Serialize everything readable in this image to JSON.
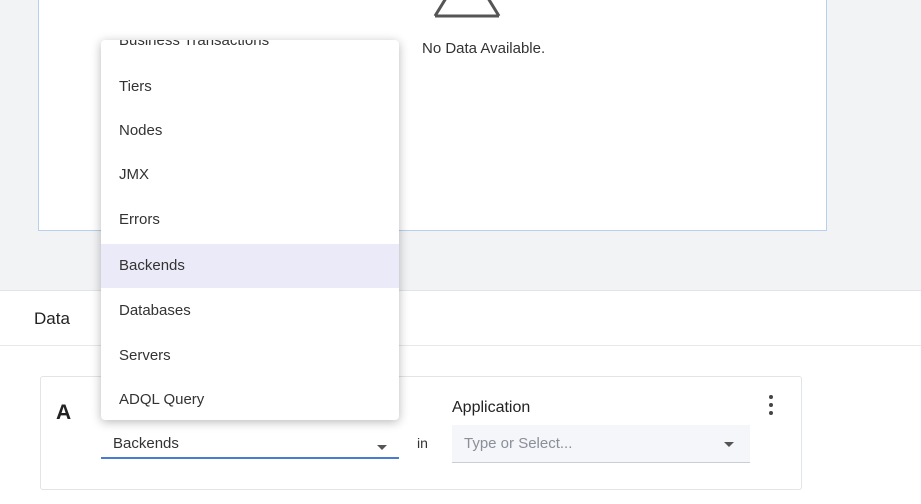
{
  "widget": {
    "no_data_text": "No Data Available.",
    "no_data_icon": "warning-triangle-icon"
  },
  "data_section": {
    "title": "Data"
  },
  "query": {
    "letter": "A",
    "metric_value": "Backends",
    "in_label": "in",
    "application_label": "Application",
    "application_placeholder": "Type or Select...",
    "menu_icon": "kebab-menu-icon"
  },
  "dropdown": {
    "items": [
      {
        "label": "Business Transactions"
      },
      {
        "label": "Tiers"
      },
      {
        "label": "Nodes"
      },
      {
        "label": "JMX"
      },
      {
        "label": "Errors"
      },
      {
        "label": "Backends",
        "selected": true
      },
      {
        "label": "Databases"
      },
      {
        "label": "Servers"
      },
      {
        "label": "ADQL Query"
      }
    ]
  },
  "colors": {
    "accent": "#4a7bd4",
    "selected_bg": "#ebeaf8",
    "panel_border": "#b8d0ee"
  }
}
